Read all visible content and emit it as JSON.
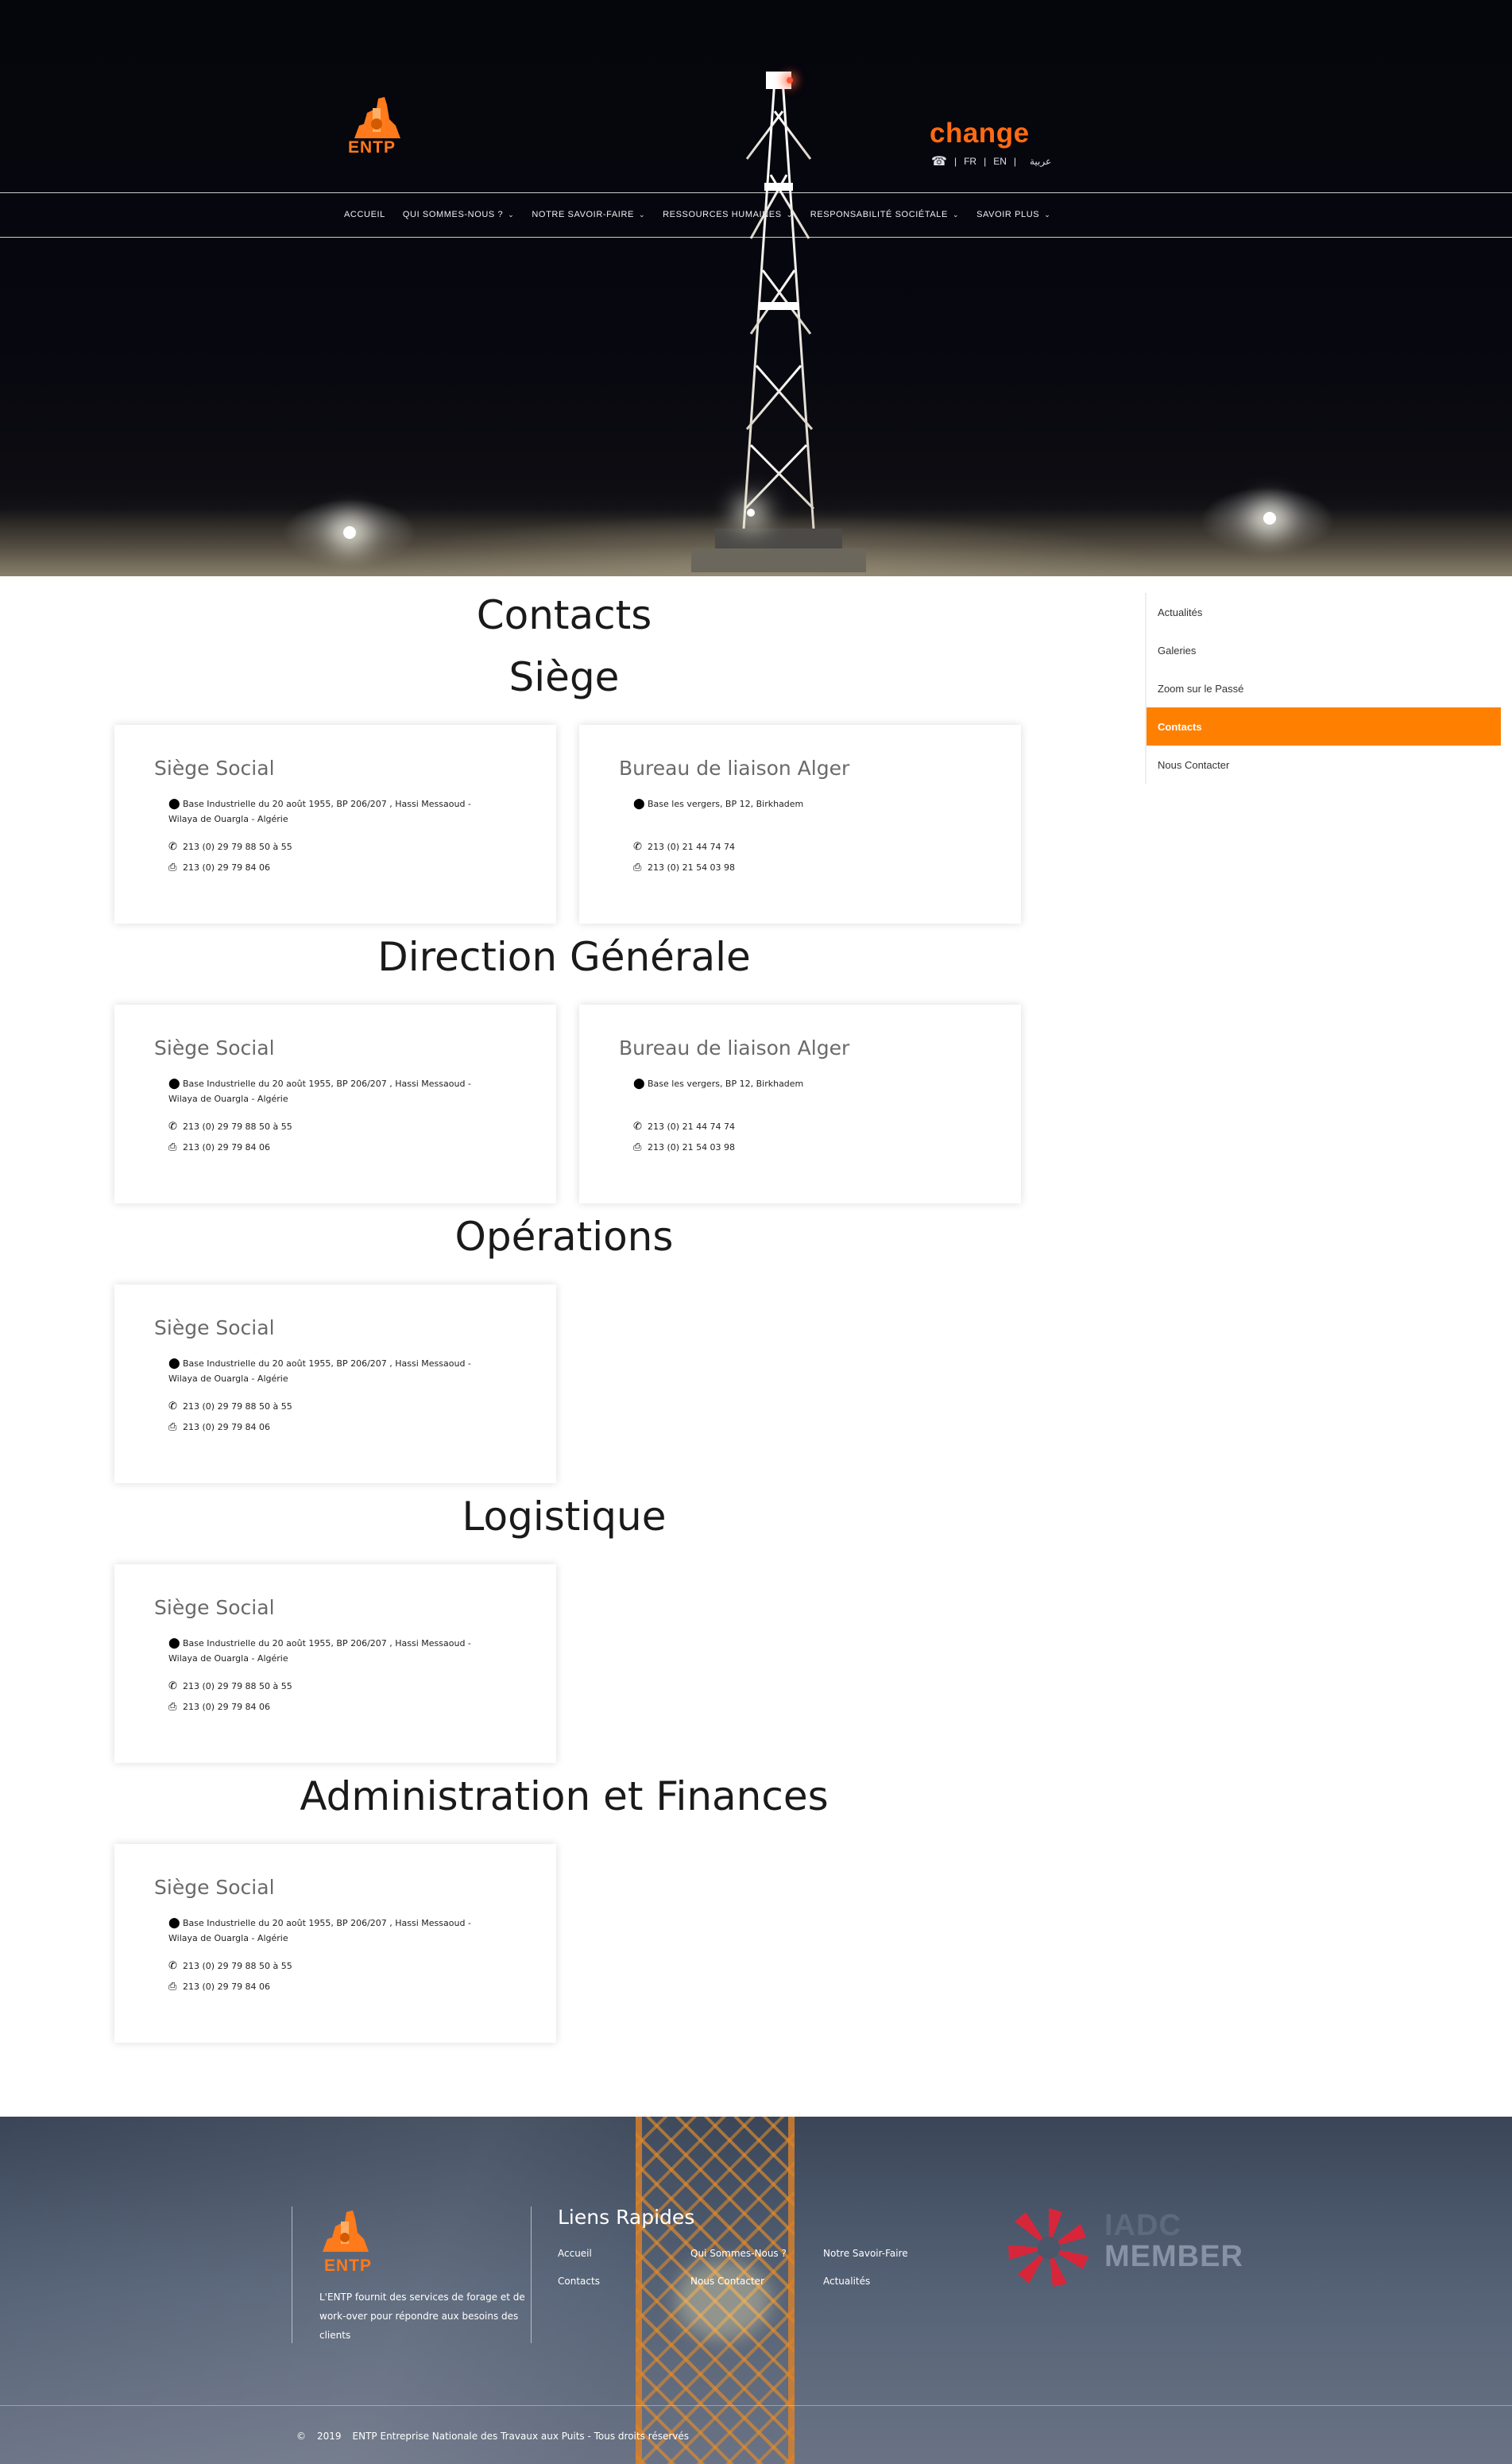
{
  "header": {
    "logo_text": "ENTP",
    "change_text": "change",
    "languages": {
      "fr": "FR",
      "en": "EN",
      "ar": "عربية"
    },
    "nav": [
      {
        "label": "ACCUEIL",
        "dropdown": false
      },
      {
        "label": "QUI SOMMES-NOUS ?",
        "dropdown": true
      },
      {
        "label": "NOTRE SAVOIR-FAIRE",
        "dropdown": true
      },
      {
        "label": "RESSOURCES HUMAINES",
        "dropdown": true
      },
      {
        "label": "RESPONSABILITÉ SOCIÉTALE",
        "dropdown": true
      },
      {
        "label": "SAVOIR PLUS",
        "dropdown": true
      }
    ]
  },
  "main": {
    "title": "Contacts",
    "sections": [
      {
        "title": "Siège",
        "cards": [
          {
            "title": "Siège Social",
            "address_line1": "Base Industrielle du 20 août 1955, BP 206/207 , Hassi Messaoud -",
            "address_line2": "Wilaya de Ouargla - Algérie",
            "phone": "213 (0) 29 79 88 50 à 55",
            "fax": "213 (0) 29 79 84 06"
          },
          {
            "title": "Bureau de liaison Alger",
            "address_line1": "Base les vergers, BP 12, Birkhadem",
            "address_line2": "",
            "phone": "213 (0) 21 44 74 74",
            "fax": "213 (0) 21 54 03 98"
          }
        ]
      },
      {
        "title": "Direction Générale",
        "cards": [
          {
            "title": "Siège Social",
            "address_line1": "Base Industrielle du 20 août 1955, BP 206/207 , Hassi Messaoud -",
            "address_line2": "Wilaya de Ouargla - Algérie",
            "phone": "213 (0) 29 79 88 50 à 55",
            "fax": "213 (0) 29 79 84 06"
          },
          {
            "title": "Bureau de liaison Alger",
            "address_line1": "Base les vergers, BP 12, Birkhadem",
            "address_line2": "",
            "phone": "213 (0) 21 44 74 74",
            "fax": "213 (0) 21 54 03 98"
          }
        ]
      },
      {
        "title": "Opérations",
        "cards": [
          {
            "title": "Siège Social",
            "address_line1": "Base Industrielle du 20 août 1955, BP 206/207 , Hassi Messaoud -",
            "address_line2": "Wilaya de Ouargla - Algérie",
            "phone": "213 (0) 29 79 88 50 à 55",
            "fax": "213 (0) 29 79 84 06"
          }
        ]
      },
      {
        "title": "Logistique",
        "cards": [
          {
            "title": "Siège Social",
            "address_line1": "Base Industrielle du 20 août 1955, BP 206/207 , Hassi Messaoud -",
            "address_line2": "Wilaya de Ouargla - Algérie",
            "phone": "213 (0) 29 79 88 50 à 55",
            "fax": "213 (0) 29 79 84 06"
          }
        ]
      },
      {
        "title": "Administration et Finances",
        "cards": [
          {
            "title": "Siège Social",
            "address_line1": "Base Industrielle du 20 août 1955, BP 206/207 , Hassi Messaoud -",
            "address_line2": "Wilaya de Ouargla - Algérie",
            "phone": "213 (0) 29 79 88 50 à 55",
            "fax": "213 (0) 29 79 84 06"
          }
        ]
      }
    ]
  },
  "sidebar": {
    "items": [
      {
        "label": "Actualités",
        "active": false
      },
      {
        "label": "Galeries",
        "active": false
      },
      {
        "label": "Zoom sur le Passé",
        "active": false
      },
      {
        "label": "Contacts",
        "active": true
      },
      {
        "label": "Nous Contacter",
        "active": false
      }
    ]
  },
  "footer": {
    "logo_text": "ENTP",
    "description": "L'ENTP fournit des services de forage et de work-over pour répondre aux besoins des clients",
    "links_title": "Liens Rapides",
    "links": [
      "Accueil",
      "Qui Sommes-Nous ?",
      "Notre Savoir-Faire",
      "Contacts",
      "Nous Contacter",
      "Actualités"
    ],
    "iadc_line1": "IADC",
    "iadc_line2": "MEMBER",
    "copyright_symbol": "©",
    "copyright_year": "2019",
    "copyright_text": "ENTP Entreprise Nationale des Travaux aux Puits - Tous droits réservés"
  },
  "colors": {
    "brand_orange": "#ff8000",
    "change_orange": "#ff6a13",
    "hero_dark": "#05050c",
    "footer_blue": "#4a5669"
  }
}
